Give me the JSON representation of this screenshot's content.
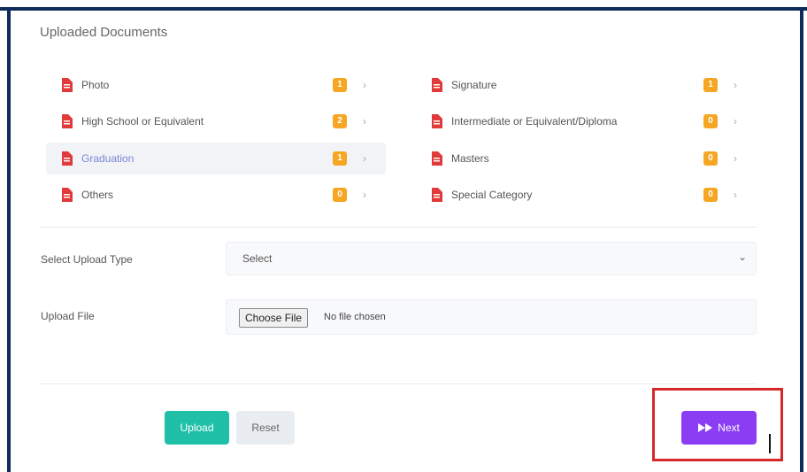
{
  "page": {
    "title": "Uploaded Documents"
  },
  "colors": {
    "frame": "#0f2b5b",
    "badge": "#f5a623",
    "pdf_icon": "#e03a3a",
    "upload_btn": "#20c0a8",
    "next_btn": "#8b3df4",
    "highlight": "#d62828"
  },
  "documents": [
    {
      "label": "Photo",
      "count": "1",
      "icon": "file-pdf-icon"
    },
    {
      "label": "Signature",
      "count": "1",
      "icon": "file-pdf-icon"
    },
    {
      "label": "High School or Equivalent",
      "count": "2",
      "icon": "file-pdf-icon"
    },
    {
      "label": "Intermediate or Equivalent/Diploma",
      "count": "0",
      "icon": "file-pdf-icon"
    },
    {
      "label": "Graduation",
      "count": "1",
      "icon": "file-pdf-icon",
      "active": true
    },
    {
      "label": "Masters",
      "count": "0",
      "icon": "file-pdf-icon"
    },
    {
      "label": "Others",
      "count": "0",
      "icon": "file-pdf-icon"
    },
    {
      "label": "Special Category",
      "count": "0",
      "icon": "file-pdf-icon"
    }
  ],
  "form": {
    "upload_type_label": "Select Upload Type",
    "upload_type_value": "Select",
    "upload_file_label": "Upload File",
    "choose_file_label": "Choose File",
    "no_file_text": "No file chosen"
  },
  "buttons": {
    "upload": "Upload",
    "reset": "Reset",
    "next": "Next"
  }
}
